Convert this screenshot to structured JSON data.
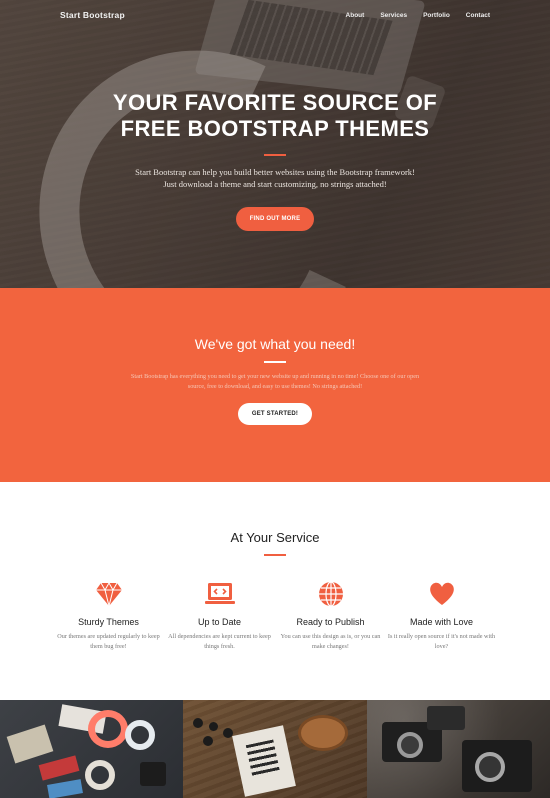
{
  "nav": {
    "brand": "Start Bootstrap",
    "links": [
      "About",
      "Services",
      "Portfolio",
      "Contact"
    ]
  },
  "hero": {
    "title_line1": "YOUR FAVORITE SOURCE OF",
    "title_line2": "FREE BOOTSTRAP THEMES",
    "text": "Start Bootstrap can help you build better websites using the Bootstrap framework! Just download a theme and start customizing, no strings attached!",
    "button": "FIND OUT MORE"
  },
  "about": {
    "title": "We've got what you need!",
    "text": "Start Bootstrap has everything you need to get your new website up and running in no time! Choose one of our open source, free to download, and easy to use themes! No strings attached!",
    "button": "GET STARTED!"
  },
  "services": {
    "title": "At Your Service",
    "items": [
      {
        "icon": "diamond-icon",
        "title": "Sturdy Themes",
        "text": "Our themes are updated regularly to keep them bug free!"
      },
      {
        "icon": "laptop-code-icon",
        "title": "Up to Date",
        "text": "All dependencies are kept current to keep things fresh."
      },
      {
        "icon": "globe-icon",
        "title": "Ready to Publish",
        "text": "You can use this design as is, or you can make changes!"
      },
      {
        "icon": "heart-icon",
        "title": "Made with Love",
        "text": "Is it really open source if it's not made with love?"
      }
    ]
  },
  "colors": {
    "accent": "#f05f40",
    "orange_section": "#f2643e"
  }
}
